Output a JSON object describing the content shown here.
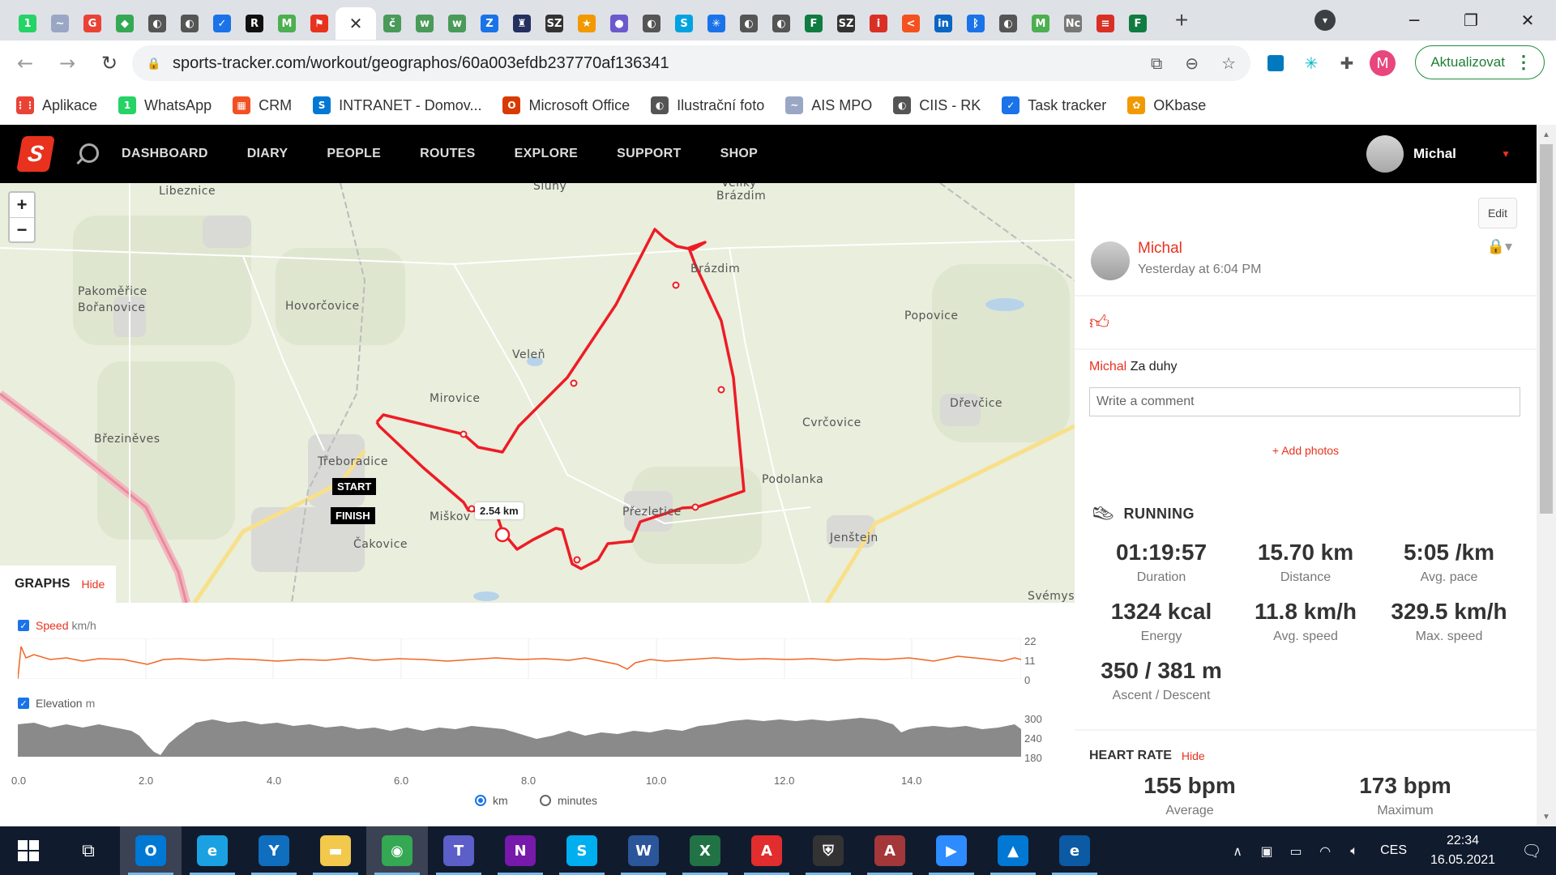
{
  "browser": {
    "tabs": [
      {
        "icon": "whatsapp-icon",
        "glyph": "1",
        "color": "#25d366"
      },
      {
        "icon": "ais-icon",
        "glyph": "~",
        "color": "#9aa7c4"
      },
      {
        "icon": "google-icon",
        "glyph": "G",
        "color": "#ea4335"
      },
      {
        "icon": "maps-icon",
        "glyph": "◆",
        "color": "#34a853"
      },
      {
        "icon": "globe-icon",
        "glyph": "◐",
        "color": "#555"
      },
      {
        "icon": "globe-icon",
        "glyph": "◐",
        "color": "#555"
      },
      {
        "icon": "tasks-icon",
        "glyph": "✓",
        "color": "#1a73e8"
      },
      {
        "icon": "r-icon",
        "glyph": "R",
        "color": "#111"
      },
      {
        "icon": "m-icon",
        "glyph": "M",
        "color": "#4caf50"
      },
      {
        "icon": "sportstracker-icon",
        "glyph": "⚑",
        "color": "#e8321e"
      },
      {
        "icon": "close-icon",
        "glyph": "✕",
        "color": "#333",
        "active": true
      },
      {
        "icon": "cssz-icon",
        "glyph": "č",
        "color": "#4a9a5a"
      },
      {
        "icon": "w-icon",
        "glyph": "w",
        "color": "#4a9a5a"
      },
      {
        "icon": "w-icon",
        "glyph": "w",
        "color": "#4a9a5a"
      },
      {
        "icon": "z-icon",
        "glyph": "Z",
        "color": "#1a73e8"
      },
      {
        "icon": "crest-icon",
        "glyph": "♜",
        "color": "#24305e"
      },
      {
        "icon": "sz-icon",
        "glyph": "SZ",
        "color": "#333"
      },
      {
        "icon": "star-icon",
        "glyph": "★",
        "color": "#f29900"
      },
      {
        "icon": "planet-icon",
        "glyph": "●",
        "color": "#6a5acd"
      },
      {
        "icon": "globe-icon",
        "glyph": "◐",
        "color": "#555"
      },
      {
        "icon": "s-icon",
        "glyph": "S",
        "color": "#00a3e0"
      },
      {
        "icon": "network-icon",
        "glyph": "✳",
        "color": "#1a73e8"
      },
      {
        "icon": "globe-icon",
        "glyph": "◐",
        "color": "#555"
      },
      {
        "icon": "globe-icon",
        "glyph": "◐",
        "color": "#555"
      },
      {
        "icon": "sheet-icon",
        "glyph": "F",
        "color": "#107c41"
      },
      {
        "icon": "sz-icon",
        "glyph": "SZ",
        "color": "#333"
      },
      {
        "icon": "info-icon",
        "glyph": "i",
        "color": "#d93025"
      },
      {
        "icon": "arrow-icon",
        "glyph": "<",
        "color": "#f4511e"
      },
      {
        "icon": "linkedin-icon",
        "glyph": "in",
        "color": "#0a66c2"
      },
      {
        "icon": "bluetooth-icon",
        "glyph": "ᛒ",
        "color": "#1a73e8"
      },
      {
        "icon": "globe-icon",
        "glyph": "◐",
        "color": "#555"
      },
      {
        "icon": "m-icon",
        "glyph": "M",
        "color": "#4caf50"
      },
      {
        "icon": "nc-icon",
        "glyph": "Nc",
        "color": "#777"
      },
      {
        "icon": "doc-icon",
        "glyph": "≡",
        "color": "#d93025"
      },
      {
        "icon": "sheet-icon",
        "glyph": "F",
        "color": "#107c41"
      }
    ],
    "url": "sports-tracker.com/workout/geographos/60a003efdb237770af136341",
    "update_label": "Aktualizovat",
    "profile_initial": "M",
    "bookmarks": [
      {
        "label": "Aplikace",
        "icon": "apps-grid-icon",
        "glyph": "⋮⋮",
        "color": "#ea4335"
      },
      {
        "label": "WhatsApp",
        "icon": "whatsapp-icon",
        "glyph": "1",
        "color": "#25d366"
      },
      {
        "label": "CRM",
        "icon": "windows-icon",
        "glyph": "▦",
        "color": "#f25022"
      },
      {
        "label": "INTRANET - Domov...",
        "icon": "sharepoint-icon",
        "glyph": "S",
        "color": "#0078d4"
      },
      {
        "label": "Microsoft Office",
        "icon": "office-icon",
        "glyph": "O",
        "color": "#d83b01"
      },
      {
        "label": "Ilustrační foto",
        "icon": "globe-icon",
        "glyph": "◐",
        "color": "#555"
      },
      {
        "label": "AIS MPO",
        "icon": "ais-icon",
        "glyph": "~",
        "color": "#9aa7c4"
      },
      {
        "label": "CIIS - RK",
        "icon": "globe-icon",
        "glyph": "◐",
        "color": "#555"
      },
      {
        "label": "Task tracker",
        "icon": "tasks-icon",
        "glyph": "✓",
        "color": "#1a73e8"
      },
      {
        "label": "OKbase",
        "icon": "okbase-icon",
        "glyph": "✿",
        "color": "#f29900"
      }
    ]
  },
  "site": {
    "nav": [
      "DASHBOARD",
      "DIARY",
      "PEOPLE",
      "ROUTES",
      "EXPLORE",
      "SUPPORT",
      "SHOP"
    ],
    "user": "Michal",
    "accent": "#e8321e"
  },
  "map": {
    "zoom_in": "+",
    "zoom_out": "−",
    "start": "START",
    "finish": "FINISH",
    "lap_label": "2.54 km",
    "places": [
      "Libeznice",
      "Sluhy",
      "Veliky",
      "Brázdim",
      "Brázdim",
      "Pakoměřice",
      "Bořanovice",
      "Hovorčovice",
      "Popovice",
      "Veleň",
      "Mirovice",
      "Dřevčice",
      "Cvrčovice",
      "Březiněves",
      "Třeboradice",
      "Podolanka",
      "Miškov",
      "Přezletice",
      "Jenštejn",
      "Čakovice",
      "Svémys"
    ]
  },
  "graphs": {
    "title": "GRAPHS",
    "hide": "Hide",
    "speed": {
      "label": "Speed",
      "unit": "km/h",
      "yticks": [
        "22",
        "11",
        "0"
      ]
    },
    "elevation": {
      "label": "Elevation",
      "unit": "m",
      "yticks": [
        "300",
        "240",
        "180"
      ]
    },
    "xticks": [
      "0.0",
      "2.0",
      "4.0",
      "6.0",
      "8.0",
      "10.0",
      "12.0",
      "14.0"
    ],
    "unit_km": "km",
    "unit_minutes": "minutes",
    "selected_unit": "km"
  },
  "workout": {
    "edit": "Edit",
    "user": "Michal",
    "time": "Yesterday at 6:04 PM",
    "comment_author": "Michal",
    "comment_text": "Za duhy",
    "comment_placeholder": "Write a comment",
    "add_photos": "+ Add photos",
    "sport": "RUNNING",
    "stats": [
      {
        "value": "01:19:57",
        "label": "Duration"
      },
      {
        "value": "15.70 km",
        "label": "Distance"
      },
      {
        "value": "5:05 /km",
        "label": "Avg. pace"
      },
      {
        "value": "1324 kcal",
        "label": "Energy"
      },
      {
        "value": "11.8 km/h",
        "label": "Avg. speed"
      },
      {
        "value": "329.5 km/h",
        "label": "Max. speed"
      },
      {
        "value": "350 / 381 m",
        "label": "Ascent / Descent"
      }
    ],
    "heart_rate": {
      "title": "HEART RATE",
      "hide": "Hide",
      "stats": [
        {
          "value": "155 bpm",
          "label": "Average"
        },
        {
          "value": "173 bpm",
          "label": "Maximum"
        }
      ]
    }
  },
  "taskbar": {
    "apps": [
      {
        "icon": "outlook-icon",
        "glyph": "O",
        "color": "#0078d4",
        "active": true
      },
      {
        "icon": "internet-explorer-icon",
        "glyph": "e",
        "color": "#1ba1e2"
      },
      {
        "icon": "yammer-icon",
        "glyph": "Y",
        "color": "#106ebe"
      },
      {
        "icon": "file-explorer-icon",
        "glyph": "▬",
        "color": "#f2c94c"
      },
      {
        "icon": "chrome-icon",
        "glyph": "◉",
        "color": "#34a853",
        "active": true
      },
      {
        "icon": "teams-icon",
        "glyph": "T",
        "color": "#5b5fc7"
      },
      {
        "icon": "onenote-icon",
        "glyph": "N",
        "color": "#7719aa"
      },
      {
        "icon": "skype-icon",
        "glyph": "S",
        "color": "#00aff0"
      },
      {
        "icon": "word-icon",
        "glyph": "W",
        "color": "#2b579a"
      },
      {
        "icon": "excel-icon",
        "glyph": "X",
        "color": "#217346"
      },
      {
        "icon": "pdf-icon",
        "glyph": "A",
        "color": "#e12d2d"
      },
      {
        "icon": "security-icon",
        "glyph": "⛨",
        "color": "#333"
      },
      {
        "icon": "access-icon",
        "glyph": "A",
        "color": "#a4373a"
      },
      {
        "icon": "zoom-icon",
        "glyph": "▶",
        "color": "#2d8cff"
      },
      {
        "icon": "photos-icon",
        "glyph": "▲",
        "color": "#0078d4"
      },
      {
        "icon": "edge-icon",
        "glyph": "e",
        "color": "#0c59a4"
      }
    ],
    "language": "CES",
    "time": "22:34",
    "date": "16.05.2021"
  }
}
